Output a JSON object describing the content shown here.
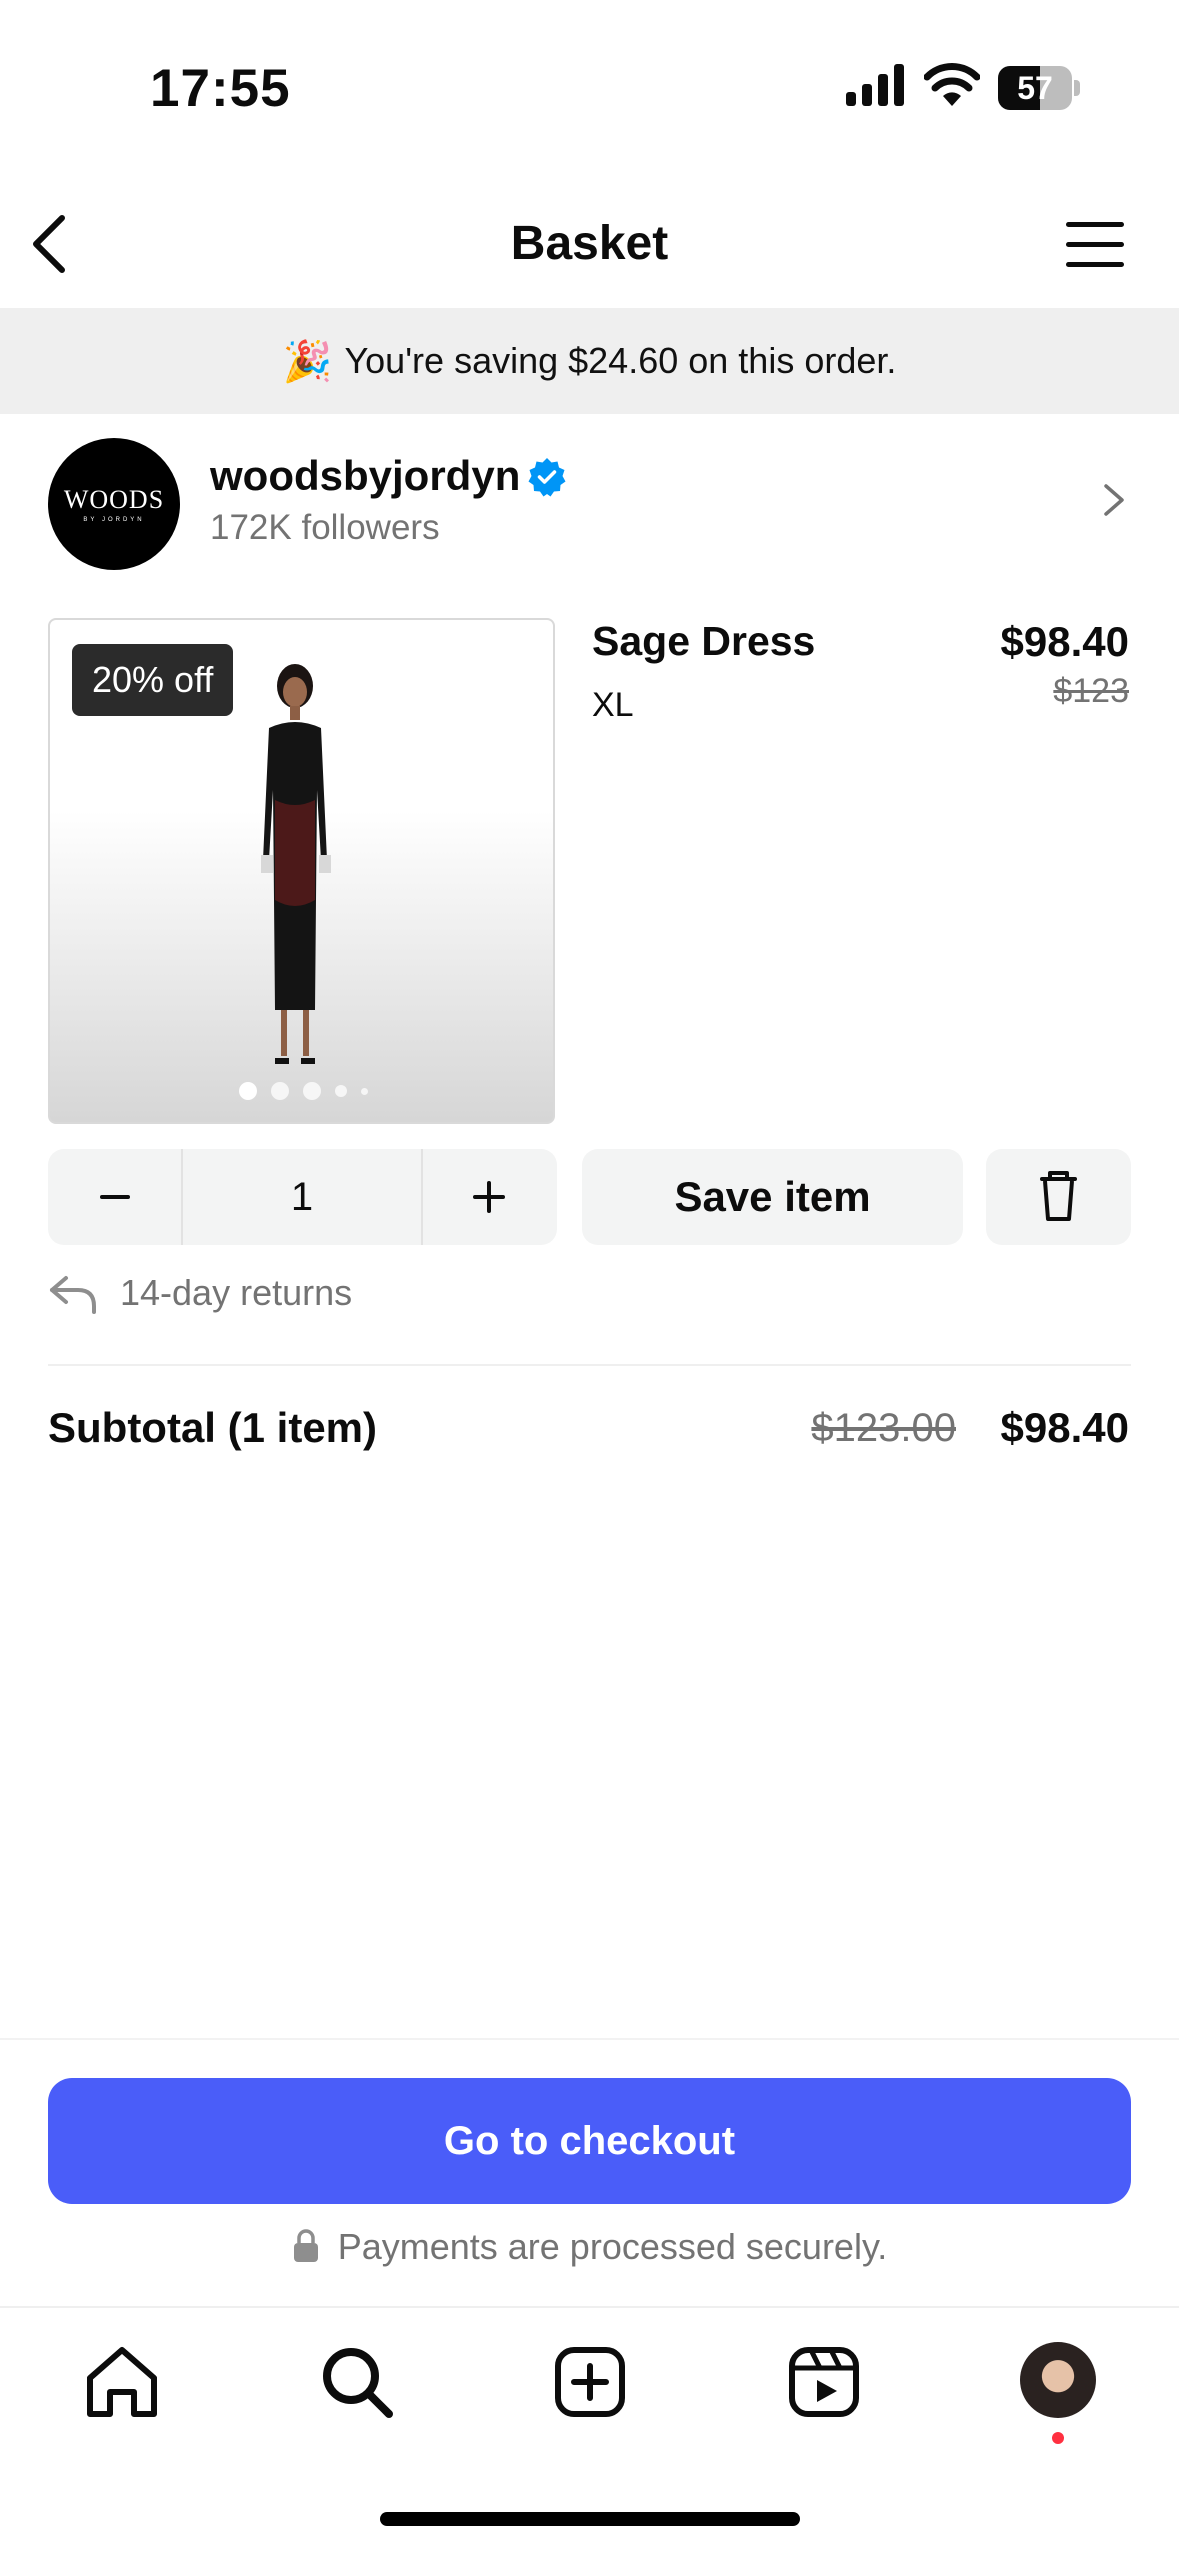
{
  "status_bar": {
    "time": "17:55",
    "battery": "57",
    "battery_level": 0.57
  },
  "header": {
    "title": "Basket"
  },
  "banner": {
    "emoji": "🎉",
    "text": "You're saving $24.60 on this order."
  },
  "seller": {
    "logo_text": "WOODS",
    "logo_subtext": "BY JORDYN",
    "name": "woodsbyjordyn",
    "followers": "172K followers"
  },
  "item": {
    "discount_badge": "20% off",
    "name": "Sage Dress",
    "size": "XL",
    "price": "$98.40",
    "original_price": "$123",
    "quantity": "1",
    "save_label": "Save item",
    "returns": "14-day returns",
    "image_dots": 5,
    "active_image": 1
  },
  "subtotal": {
    "label": "Subtotal (1 item)",
    "original": "$123.00",
    "total": "$98.40"
  },
  "checkout": {
    "button_label": "Go to checkout",
    "secure_note": "Payments are processed securely."
  },
  "tab_bar": {
    "items": [
      "home-icon",
      "search-icon",
      "create-icon",
      "reels-icon",
      "profile-avatar"
    ]
  },
  "colors": {
    "accent": "#4a5df9",
    "verified": "#0095f6",
    "muted": "#737373",
    "notification": "#ff3040"
  }
}
